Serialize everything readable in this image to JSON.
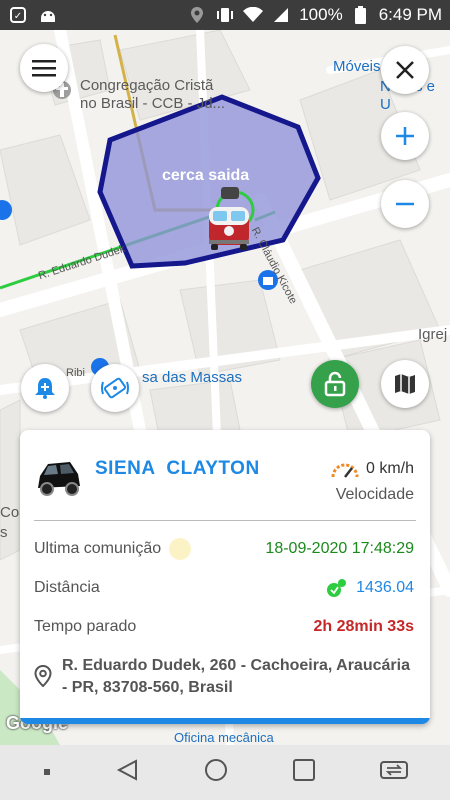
{
  "status_bar": {
    "battery": "100%",
    "time": "6:49 PM"
  },
  "map": {
    "labels": {
      "church": "Congregação Cristã\nno Brasil - CCB - Jd...",
      "moveis": "Móveis Seb",
      "moveis2": "Novos e U",
      "igreja": "Igrej",
      "street_dudek": "R. Eduardo Dudek",
      "street_claudio": "R. Cláudio Kicote",
      "casa_massas": "sa das Massas",
      "ribi": "Ribi",
      "con": "Con",
      "s": "s",
      "oficina": "Oficina mecânica",
      "google": "Google"
    },
    "fence_name": "cerca saida"
  },
  "card": {
    "vehicle_name": "SIENA  CLAYTON",
    "speed": "0 km/h",
    "speed_label": "Velocidade",
    "last_comm_label": "Ultima comunição",
    "last_comm_value": "18-09-2020 17:48:29",
    "distance_label": "Distância",
    "distance_value": "1436.04",
    "stopped_label": "Tempo parado",
    "stopped_value": "2h 28min 33s",
    "address": "R. Eduardo Dudek, 260 - Cachoeira, Araucária - PR, 83708-560, Brasil"
  },
  "colors": {
    "accent": "#1e88e5",
    "green_value": "#1a8a1a",
    "red_value": "#c62828",
    "fence_fill": "#8e92d9",
    "fence_stroke": "#15178c"
  }
}
